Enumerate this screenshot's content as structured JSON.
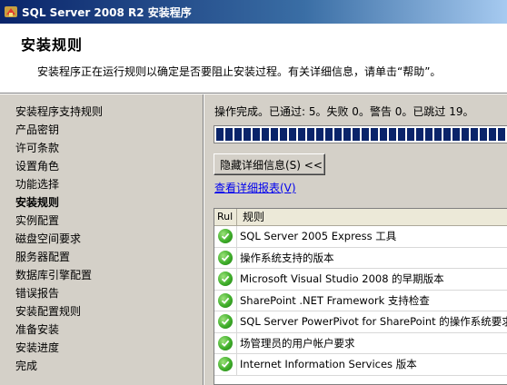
{
  "window": {
    "title": "SQL Server 2008 R2 安装程序",
    "app_icon": "sql-server-setup-icon"
  },
  "header": {
    "title": "安装规则",
    "description": "安装程序正在运行规则以确定是否要阻止安装过程。有关详细信息，请单击“帮助”。"
  },
  "sidebar": {
    "items": [
      {
        "label": "安装程序支持规则",
        "active": false
      },
      {
        "label": "产品密钥",
        "active": false
      },
      {
        "label": "许可条款",
        "active": false
      },
      {
        "label": "设置角色",
        "active": false
      },
      {
        "label": "功能选择",
        "active": false
      },
      {
        "label": "安装规则",
        "active": true
      },
      {
        "label": "实例配置",
        "active": false
      },
      {
        "label": "磁盘空间要求",
        "active": false
      },
      {
        "label": "服务器配置",
        "active": false
      },
      {
        "label": "数据库引擎配置",
        "active": false
      },
      {
        "label": "错误报告",
        "active": false
      },
      {
        "label": "安装配置规则",
        "active": false
      },
      {
        "label": "准备安装",
        "active": false
      },
      {
        "label": "安装进度",
        "active": false
      },
      {
        "label": "完成",
        "active": false
      }
    ]
  },
  "main": {
    "status": "操作完成。已通过: 5。失败 0。警告 0。已跳过 19。",
    "progress_fraction": 1.0,
    "hide_details_button": "隐藏详细信息(S) <<",
    "view_report_link": "查看详细报表(V)",
    "table": {
      "columns": [
        "Rul",
        "规则"
      ],
      "rows": [
        {
          "status_icon": "passed-check-icon",
          "rule": "SQL Server 2005 Express 工具"
        },
        {
          "status_icon": "passed-check-icon",
          "rule": "操作系统支持的版本"
        },
        {
          "status_icon": "passed-check-icon",
          "rule": "Microsoft Visual Studio 2008 的早期版本"
        },
        {
          "status_icon": "passed-check-icon",
          "rule": "SharePoint .NET Framework 支持检查"
        },
        {
          "status_icon": "passed-check-icon",
          "rule": "SQL Server PowerPivot for SharePoint 的操作系统要求"
        },
        {
          "status_icon": "passed-check-icon",
          "rule": "场管理员的用户帐户要求"
        },
        {
          "status_icon": "passed-check-icon",
          "rule": "Internet Information Services 版本"
        }
      ]
    }
  }
}
